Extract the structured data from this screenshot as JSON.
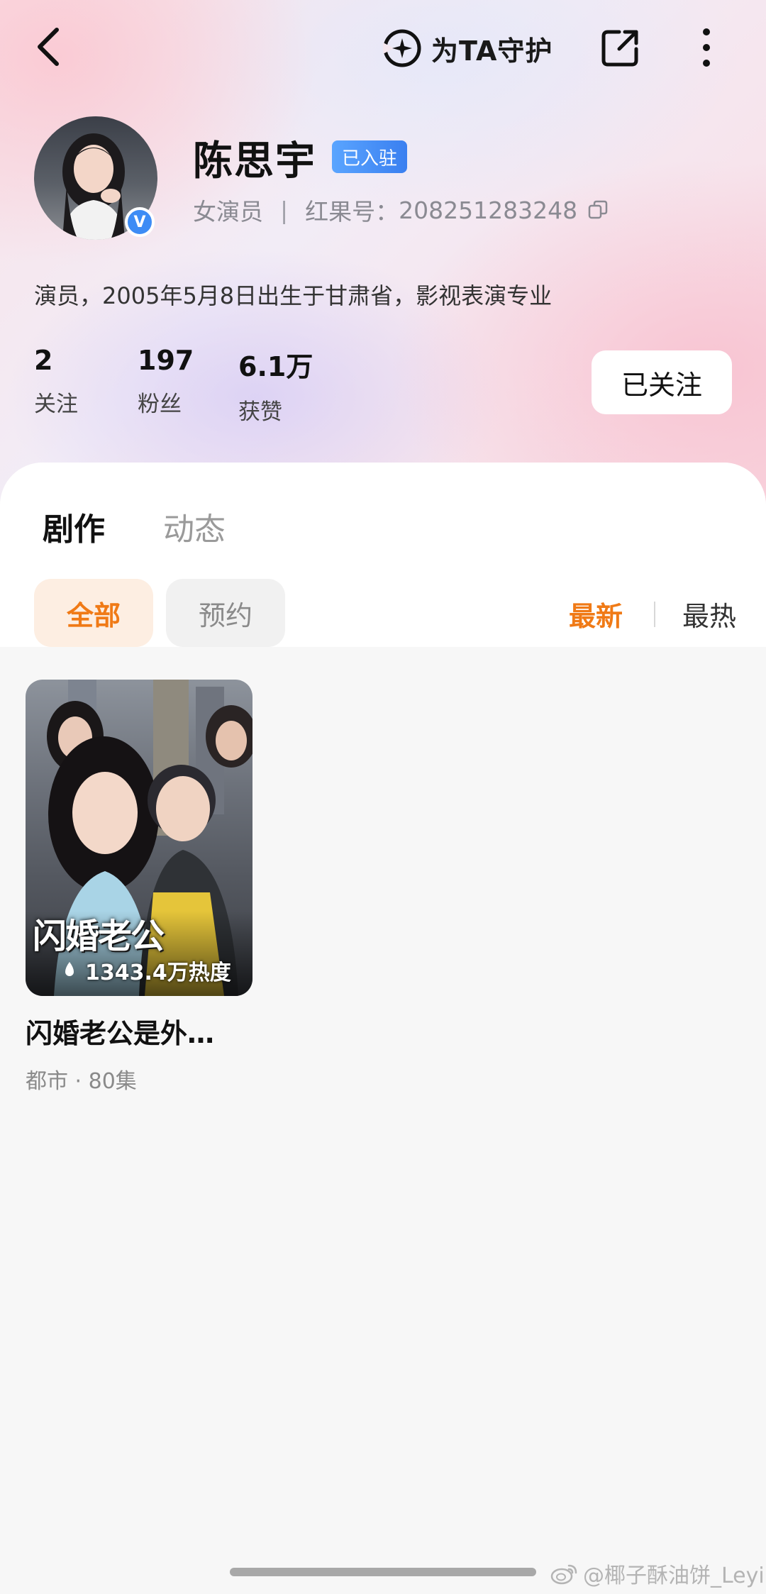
{
  "header": {
    "guard_label": "为TA守护"
  },
  "profile": {
    "name": "陈思宇",
    "status_tag": "已入驻",
    "verified_mark": "V",
    "role": "女演员",
    "id_label": "红果号：",
    "id_value": "208251283248",
    "bio": "演员，2005年5月8日出生于甘肃省，影视表演专业"
  },
  "stats": [
    {
      "value": "2",
      "label": "关注"
    },
    {
      "value": "197",
      "label": "粉丝"
    },
    {
      "value": "6.1万",
      "label": "获赞"
    }
  ],
  "follow_button": "已关注",
  "tabs": [
    "剧作",
    "动态"
  ],
  "filters": [
    "全部",
    "预约"
  ],
  "sort": [
    "最新",
    "最热"
  ],
  "dramas": [
    {
      "poster_text": "闪婚老公",
      "heat": "1343.4万热度",
      "title": "闪婚老公是外…",
      "meta": "都市 · 80集"
    }
  ],
  "watermark": "@椰子酥油饼_Leyi",
  "colors": {
    "accent": "#f07a16",
    "verified": "#3d8cf5"
  }
}
